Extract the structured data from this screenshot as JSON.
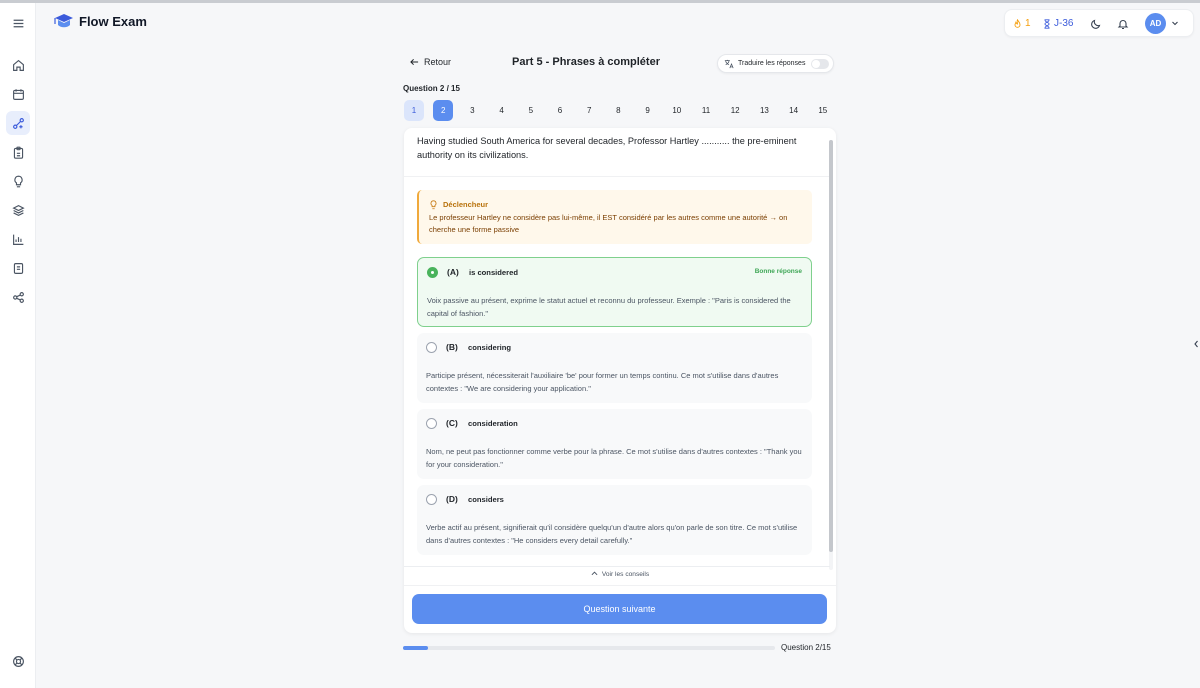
{
  "app": {
    "title": "Flow Exam"
  },
  "header": {
    "streak_count": "1",
    "countdown": "J-36",
    "avatar_initials": "AD"
  },
  "sidebar": {
    "items": [
      {
        "name": "home-icon",
        "active": false
      },
      {
        "name": "calendar-icon",
        "active": false
      },
      {
        "name": "practice-icon",
        "active": true
      },
      {
        "name": "clipboard-icon",
        "active": false
      },
      {
        "name": "lightbulb-icon",
        "active": false
      },
      {
        "name": "layers-icon",
        "active": false
      },
      {
        "name": "chart-icon",
        "active": false
      },
      {
        "name": "notebook-icon",
        "active": false
      },
      {
        "name": "share-icon",
        "active": false
      }
    ],
    "bottom_icon": "help-icon"
  },
  "page": {
    "back_label": "Retour",
    "title": "Part 5 - Phrases à compléter",
    "translate_label": "Traduire les réponses",
    "translate_on": false,
    "question_counter": "Question 2 / 15"
  },
  "question_numbers": [
    "1",
    "2",
    "3",
    "4",
    "5",
    "6",
    "7",
    "8",
    "9",
    "10",
    "11",
    "12",
    "13",
    "14",
    "15"
  ],
  "current_question": 2,
  "question": {
    "text": "Having studied South America for several decades, Professor Hartley ........... the pre-eminent authority on its civilizations."
  },
  "trigger": {
    "title": "Déclencheur",
    "text": "Le professeur Hartley ne considère pas lui-même, il EST considéré par les autres comme une autorité → on cherche une forme passive"
  },
  "options": [
    {
      "letter": "(A)",
      "answer": "is considered",
      "correct": true,
      "badge": "Bonne réponse",
      "explanation": "Voix passive au présent, exprime le statut actuel et reconnu du professeur. Exemple : \"Paris is considered the capital of fashion.\""
    },
    {
      "letter": "(B)",
      "answer": "considering",
      "correct": false,
      "badge": "",
      "explanation": "Participe présent, nécessiterait l'auxiliaire 'be' pour former un temps continu. Ce mot s'utilise dans d'autres contextes : \"We are considering your application.\""
    },
    {
      "letter": "(C)",
      "answer": "consideration",
      "correct": false,
      "badge": "",
      "explanation": "Nom, ne peut pas fonctionner comme verbe pour la phrase. Ce mot s'utilise dans d'autres contextes : \"Thank you for your consideration.\""
    },
    {
      "letter": "(D)",
      "answer": "considers",
      "correct": false,
      "badge": "",
      "explanation": "Verbe actif au présent, signifierait qu'il considère quelqu'un d'autre alors qu'on parle de son titre. Ce mot s'utilise dans d'autres contextes : \"He considers every detail carefully.\""
    }
  ],
  "footer": {
    "tips_label": "Voir les conseils",
    "next_label": "Question suivante",
    "progress_label": "Question 2/15",
    "progress_fraction": 0.0667
  },
  "colors": {
    "accent": "#5b8def",
    "correct": "#49b35c",
    "trigger_bg": "#fff8eb",
    "trigger_border": "#f0a93b"
  }
}
